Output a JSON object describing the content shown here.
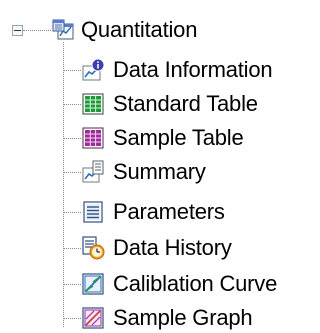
{
  "tree": {
    "root": {
      "label": "Quantitation",
      "icon": "quantitation-folder-icon",
      "expanded": true
    },
    "children": [
      {
        "label": "Data Information",
        "icon": "data-information-icon"
      },
      {
        "label": "Standard Table",
        "icon": "standard-table-icon"
      },
      {
        "label": "Sample Table",
        "icon": "sample-table-icon"
      },
      {
        "label": "Summary",
        "icon": "summary-icon"
      },
      {
        "label": "Parameters",
        "icon": "parameters-icon"
      },
      {
        "label": "Data History",
        "icon": "data-history-icon"
      },
      {
        "label": "Caliblation Curve",
        "icon": "calibration-curve-icon"
      },
      {
        "label": "Sample Graph",
        "icon": "sample-graph-icon"
      }
    ]
  },
  "colors": {
    "tree_line": "#8a8a8a",
    "table_green": "#1f9a3a",
    "table_purple": "#a0289a",
    "info_badge": "#3d3fb0",
    "graph_blue": "#2b6fb8",
    "history_orange": "#f0a020"
  }
}
